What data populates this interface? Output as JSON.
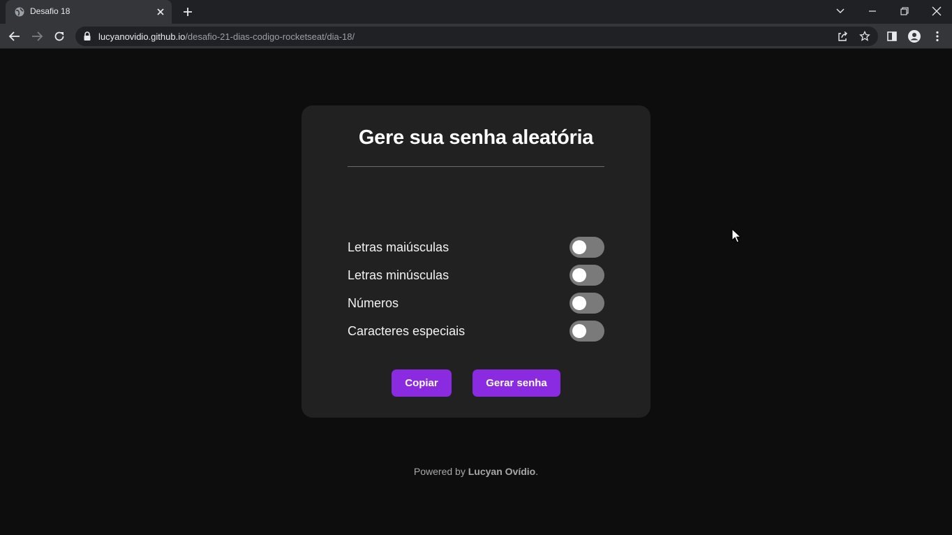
{
  "browser": {
    "tab_title": "Desafio 18",
    "url_host": "lucyanovidio.github.io",
    "url_path": "/desafio-21-dias-codigo-rocketseat/dia-18/"
  },
  "card": {
    "title": "Gere sua senha aleatória",
    "password_value": "",
    "options": [
      {
        "label": "Letras maiúsculas",
        "enabled": false
      },
      {
        "label": "Letras minúsculas",
        "enabled": false
      },
      {
        "label": "Números",
        "enabled": false
      },
      {
        "label": "Caracteres especiais",
        "enabled": false
      }
    ],
    "copy_label": "Copiar",
    "generate_label": "Gerar senha"
  },
  "footer": {
    "prefix": "Powered by",
    "author": "Lucyan Ovídio",
    "suffix": "."
  },
  "colors": {
    "accent": "#8a2be2",
    "card_bg": "#212121",
    "page_bg": "#0d0d0d"
  }
}
